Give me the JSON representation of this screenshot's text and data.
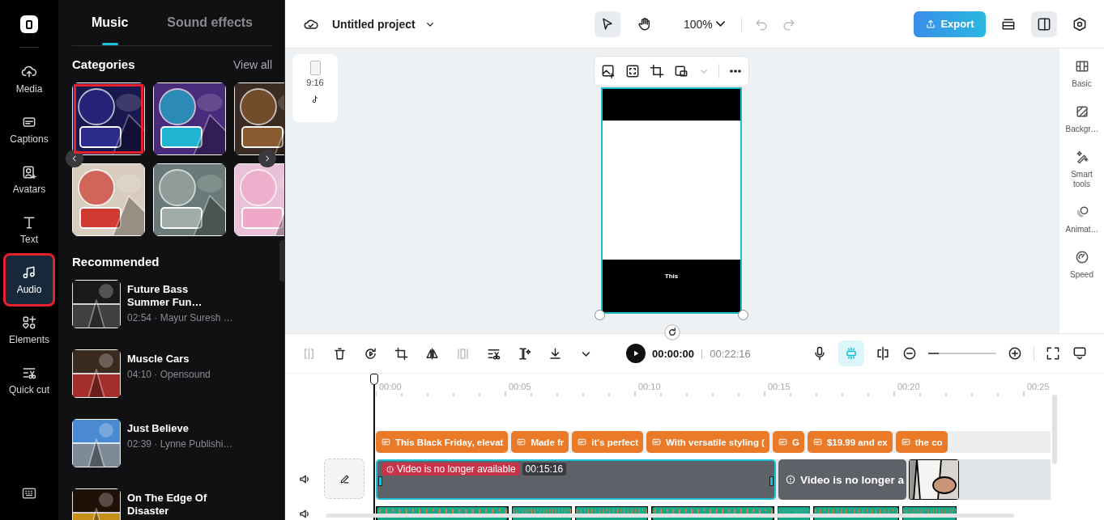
{
  "nav": {
    "items": [
      {
        "label": "Media",
        "selected": false,
        "highlighted": false
      },
      {
        "label": "Captions",
        "selected": false,
        "highlighted": false
      },
      {
        "label": "Avatars",
        "selected": false,
        "highlighted": false
      },
      {
        "label": "Text",
        "selected": false,
        "highlighted": false
      },
      {
        "label": "Audio",
        "selected": true,
        "highlighted": true
      },
      {
        "label": "Elements",
        "selected": false,
        "highlighted": false
      },
      {
        "label": "Quick cut",
        "selected": false,
        "highlighted": false
      }
    ]
  },
  "panel": {
    "tabs": [
      {
        "label": "Music",
        "selected": true
      },
      {
        "label": "Sound effects",
        "selected": false
      }
    ],
    "categories": {
      "title": "Categories",
      "view_all": "View all",
      "tiles": [
        {
          "kind": "picture",
          "highlighted": true
        },
        {
          "kind": "picture",
          "highlighted": false
        },
        {
          "kind": "picture",
          "highlighted": false
        },
        {
          "kind": "picture",
          "highlighted": false
        },
        {
          "kind": "picture",
          "highlighted": false
        },
        {
          "kind": "picture",
          "highlighted": false
        }
      ]
    },
    "recommended": {
      "title": "Recommended",
      "tracks": [
        {
          "title": "Future Bass Summer Fun…",
          "meta": "02:54 · Mayur Suresh …"
        },
        {
          "title": "Muscle Cars",
          "meta": "04:10 · Opensound"
        },
        {
          "title": "Just Believe",
          "meta": "02:39 · Lynne Publishi…"
        },
        {
          "title": "On The Edge Of Disaster"
        }
      ]
    }
  },
  "topbar": {
    "project_title": "Untitled project",
    "tools": [
      {
        "kind": "pointer",
        "selected": true
      },
      {
        "kind": "hand",
        "selected": false
      }
    ],
    "zoom": "100%",
    "export": "Export",
    "layout_toggle": {
      "selected": true
    }
  },
  "canvas": {
    "aspect": "9:16",
    "caption": "This"
  },
  "properties": {
    "items": [
      {
        "label": "Basic"
      },
      {
        "label": "Backgr…"
      },
      {
        "label": "Smart tools"
      },
      {
        "label": "Animat…"
      },
      {
        "label": "Speed"
      }
    ]
  },
  "timeline": {
    "current_time": "00:00:00",
    "total_time": "00:22:16",
    "time_separator": "|",
    "auto_snap": {
      "on": true
    },
    "zoom": {
      "level": 0.15
    },
    "ruler": [
      "00:00",
      "00:05",
      "00:10",
      "00:15",
      "00:20",
      "00:25"
    ],
    "captions": [
      "This Black Friday, elevat",
      "Made fr",
      "it's perfect",
      "With versatile styling (",
      "G",
      "$19.99 and ex",
      "the co"
    ],
    "video_clips": [
      {
        "kind": "unavailable",
        "label": "Video is no longer available",
        "duration": "00:15:16",
        "selected": true
      },
      {
        "kind": "unavailable_plain",
        "label": "Video is no longer a",
        "selected": false
      },
      {
        "kind": "picture"
      }
    ]
  }
}
